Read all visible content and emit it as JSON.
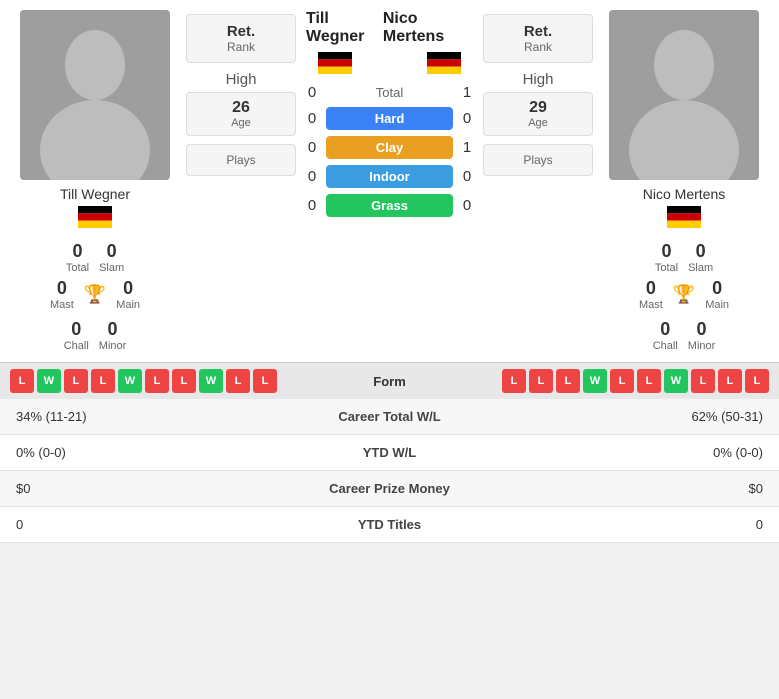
{
  "player1": {
    "name": "Till Wegner",
    "rank_label": "Ret.",
    "rank_sublabel": "Rank",
    "total": "0",
    "total_label": "Total",
    "slam": "0",
    "slam_label": "Slam",
    "mast": "0",
    "mast_label": "Mast",
    "main": "0",
    "main_label": "Main",
    "chall": "0",
    "chall_label": "Chall",
    "minor": "0",
    "minor_label": "Minor",
    "high_label": "High",
    "age": "26",
    "age_label": "Age",
    "plays_label": "Plays"
  },
  "player2": {
    "name": "Nico Mertens",
    "rank_label": "Ret.",
    "rank_sublabel": "Rank",
    "total": "0",
    "total_label": "Total",
    "slam": "0",
    "slam_label": "Slam",
    "mast": "0",
    "mast_label": "Mast",
    "main": "0",
    "main_label": "Main",
    "chall": "0",
    "chall_label": "Chall",
    "minor": "0",
    "minor_label": "Minor",
    "high_label": "High",
    "age": "29",
    "age_label": "Age",
    "plays_label": "Plays"
  },
  "surfaces": {
    "total_label": "Total",
    "p1_total": "0",
    "p2_total": "1",
    "hard_label": "Hard",
    "p1_hard": "0",
    "p2_hard": "0",
    "clay_label": "Clay",
    "p1_clay": "0",
    "p2_clay": "1",
    "indoor_label": "Indoor",
    "p1_indoor": "0",
    "p2_indoor": "0",
    "grass_label": "Grass",
    "p1_grass": "0",
    "p2_grass": "0"
  },
  "form": {
    "label": "Form",
    "p1_form": [
      "L",
      "W",
      "L",
      "L",
      "W",
      "L",
      "L",
      "W",
      "L",
      "L"
    ],
    "p2_form": [
      "L",
      "L",
      "L",
      "W",
      "L",
      "L",
      "W",
      "L",
      "L",
      "L"
    ]
  },
  "stats": [
    {
      "p1_val": "34% (11-21)",
      "label": "Career Total W/L",
      "p2_val": "62% (50-31)"
    },
    {
      "p1_val": "0% (0-0)",
      "label": "YTD W/L",
      "p2_val": "0% (0-0)"
    },
    {
      "p1_val": "$0",
      "label": "Career Prize Money",
      "p2_val": "$0"
    },
    {
      "p1_val": "0",
      "label": "YTD Titles",
      "p2_val": "0"
    }
  ]
}
